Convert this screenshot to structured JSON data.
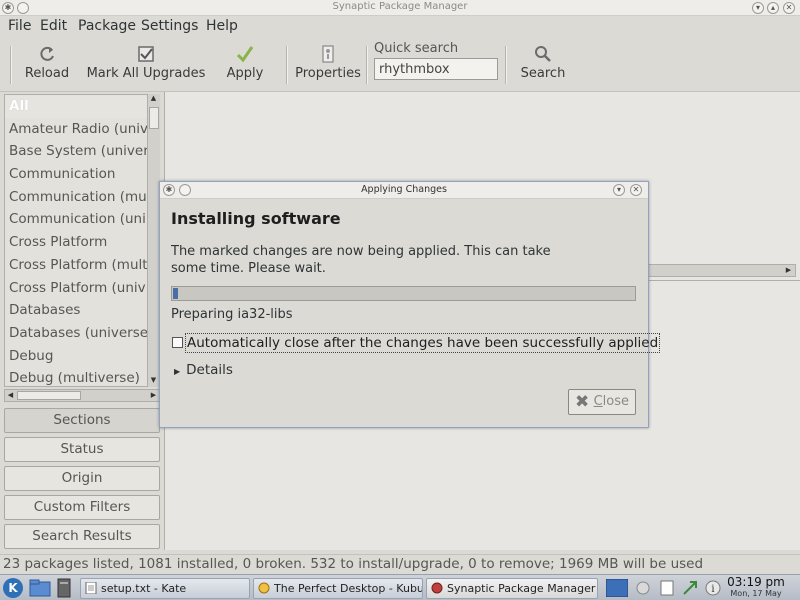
{
  "window": {
    "title": "Synaptic Package Manager"
  },
  "menu": [
    "File",
    "Edit",
    "Package",
    "Settings",
    "Help"
  ],
  "toolbar": {
    "reload": "Reload",
    "mark_all": "Mark All Upgrades",
    "apply": "Apply",
    "properties": "Properties",
    "quick_search_label": "Quick search",
    "quick_search_value": "rhythmbox",
    "search": "Search"
  },
  "sections": [
    "All",
    "Amateur Radio (univ",
    "Base System (univer",
    "Communication",
    "Communication (mu",
    "Communication (uni",
    "Cross Platform",
    "Cross Platform (mult",
    "Cross Platform (univ",
    "Databases",
    "Databases (universe)",
    "Debug",
    "Debug (multiverse)"
  ],
  "filters": {
    "sections": "Sections",
    "status": "Status",
    "origin": "Origin",
    "custom": "Custom Filters",
    "search_results": "Search Results"
  },
  "statusbar": "23 packages listed, 1081 installed, 0 broken. 532 to install/upgrade, 0 to remove; 1969 MB will be used",
  "dialog": {
    "title": "Applying Changes",
    "heading": "Installing software",
    "message": "The marked changes are now being applied. This can take some time. Please wait.",
    "progress": 0.01,
    "status": "Preparing ia32-libs",
    "auto_close": "Automatically close after the changes have been successfully applied",
    "details": "Details",
    "close_prefix": "",
    "close_accel": "C",
    "close_rest": "lose"
  },
  "taskbar": {
    "tasks": [
      "setup.txt - Kate",
      "The Perfect Desktop - Kubuntu",
      "Synaptic Package Manager"
    ],
    "time": "03:19 pm",
    "date": "Mon, 17 May"
  },
  "colors": {
    "accent": "#4a6fa5",
    "dialog_border": "#8fa4c4"
  }
}
